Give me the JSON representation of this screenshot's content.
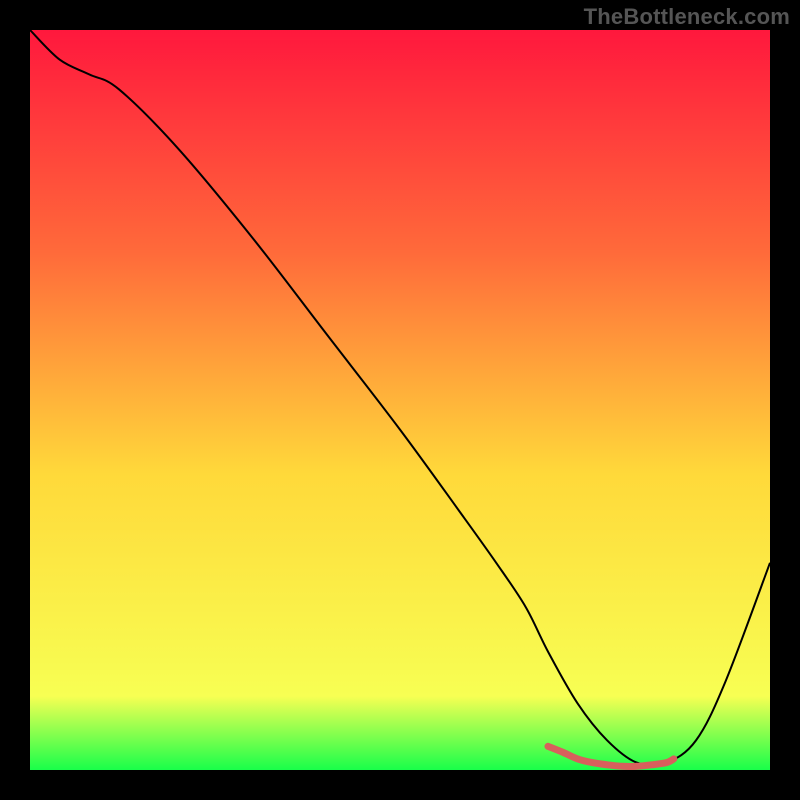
{
  "watermark": "TheBottleneck.com",
  "chart_data": {
    "type": "line",
    "title": "",
    "xlabel": "",
    "ylabel": "",
    "xlim": [
      0,
      100
    ],
    "ylim": [
      0,
      100
    ],
    "legend": false,
    "grid": false,
    "background_gradient": {
      "top": "#ff183d",
      "mid_upper": "#ff6a3a",
      "mid": "#ffd93a",
      "lower": "#f7ff53",
      "bottom": "#18ff4a"
    },
    "series": [
      {
        "name": "bottleneck-curve",
        "stroke": "#000000",
        "stroke_width": 2,
        "x": [
          0,
          4,
          8,
          12,
          20,
          30,
          40,
          50,
          58,
          63,
          67,
          70,
          74,
          78,
          82,
          86,
          90,
          94,
          100
        ],
        "y": [
          100,
          96,
          94,
          92,
          84,
          72,
          59,
          46,
          35,
          28,
          22,
          16,
          9,
          4,
          1,
          1,
          4,
          12,
          28
        ]
      },
      {
        "name": "optimal-marker",
        "stroke": "#d8605c",
        "stroke_width": 7,
        "x": [
          70,
          72,
          74,
          76,
          78,
          80,
          82,
          84,
          86,
          87
        ],
        "y": [
          3.2,
          2.4,
          1.5,
          1.0,
          0.7,
          0.5,
          0.5,
          0.7,
          1.0,
          1.5
        ]
      }
    ]
  }
}
